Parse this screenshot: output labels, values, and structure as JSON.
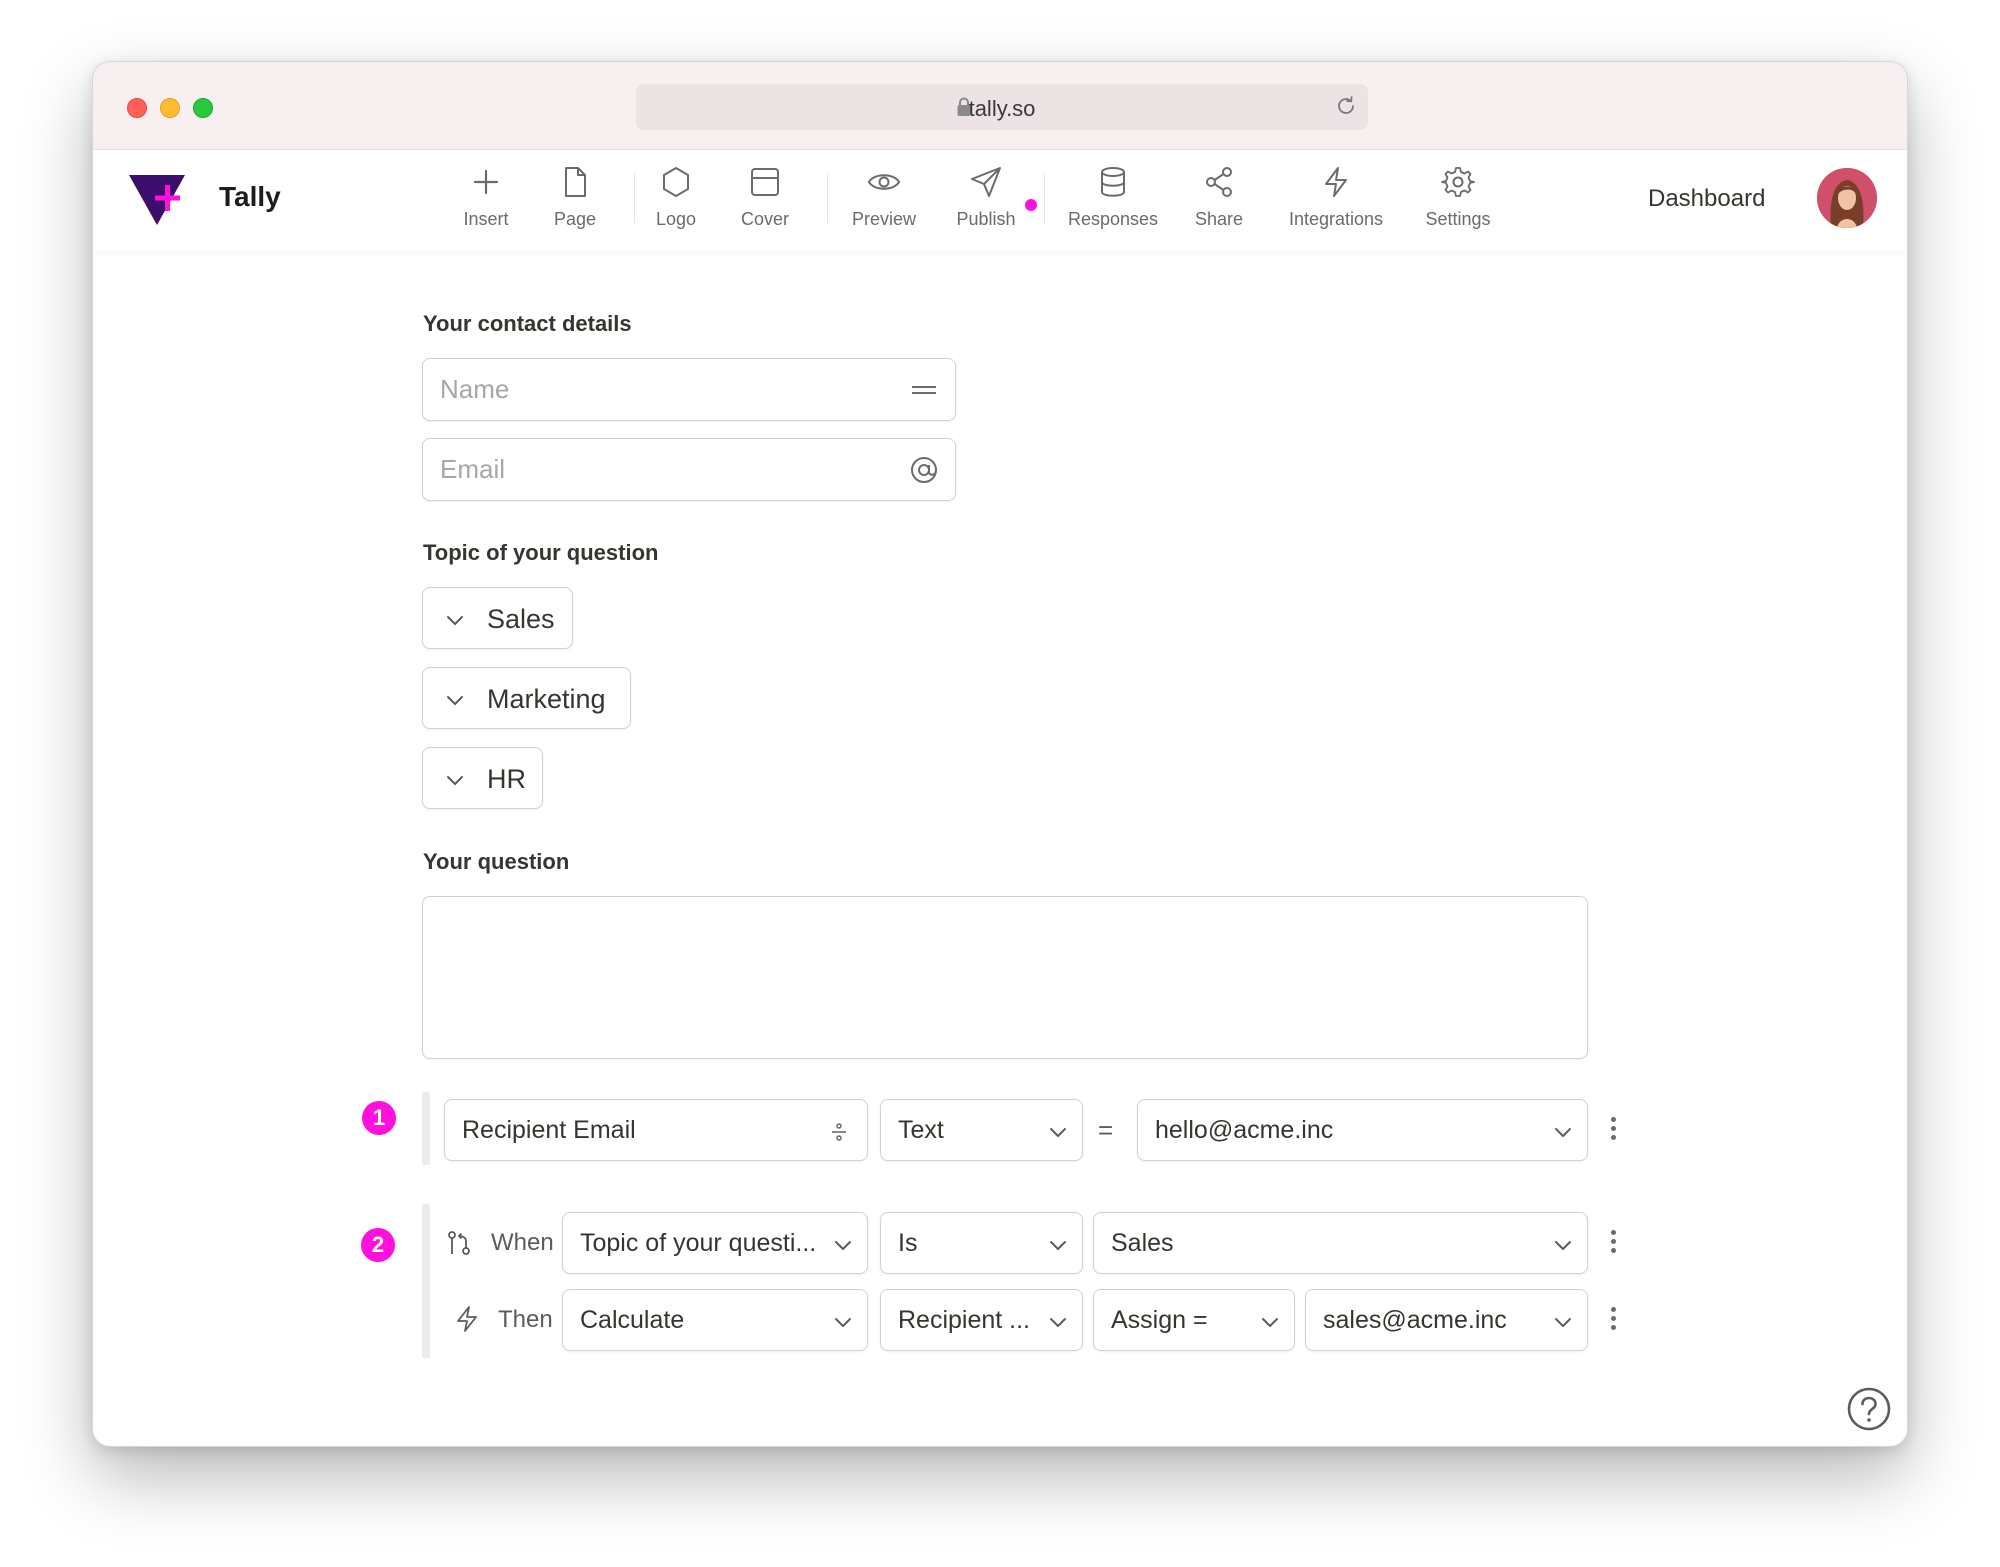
{
  "browser": {
    "url": "tally.so"
  },
  "app": {
    "brand": "Tally",
    "dashboard_label": "Dashboard"
  },
  "toolbar": {
    "insert": "Insert",
    "page": "Page",
    "logo": "Logo",
    "cover": "Cover",
    "preview": "Preview",
    "publish": "Publish",
    "responses": "Responses",
    "share": "Share",
    "integrations": "Integrations",
    "settings": "Settings"
  },
  "form": {
    "contact_label": "Your contact details",
    "name_placeholder": "Name",
    "email_placeholder": "Email",
    "topic_label": "Topic of your question",
    "topics": [
      "Sales",
      "Marketing",
      "HR"
    ],
    "question_label": "Your question"
  },
  "rules": {
    "rule1": {
      "number": "1",
      "field": "Recipient Email",
      "type": "Text",
      "equals": "=",
      "value": "hello@acme.inc"
    },
    "rule2": {
      "number": "2",
      "when_label": "When",
      "when_field": "Topic of your questi...",
      "operator": "Is",
      "when_value": "Sales",
      "then_label": "Then",
      "action": "Calculate",
      "target": "Recipient ...",
      "assign": "Assign =",
      "then_value": "sales@acme.inc"
    }
  },
  "colors": {
    "accent": "#ff10dc",
    "brand_purple": "#3d0d6b"
  }
}
